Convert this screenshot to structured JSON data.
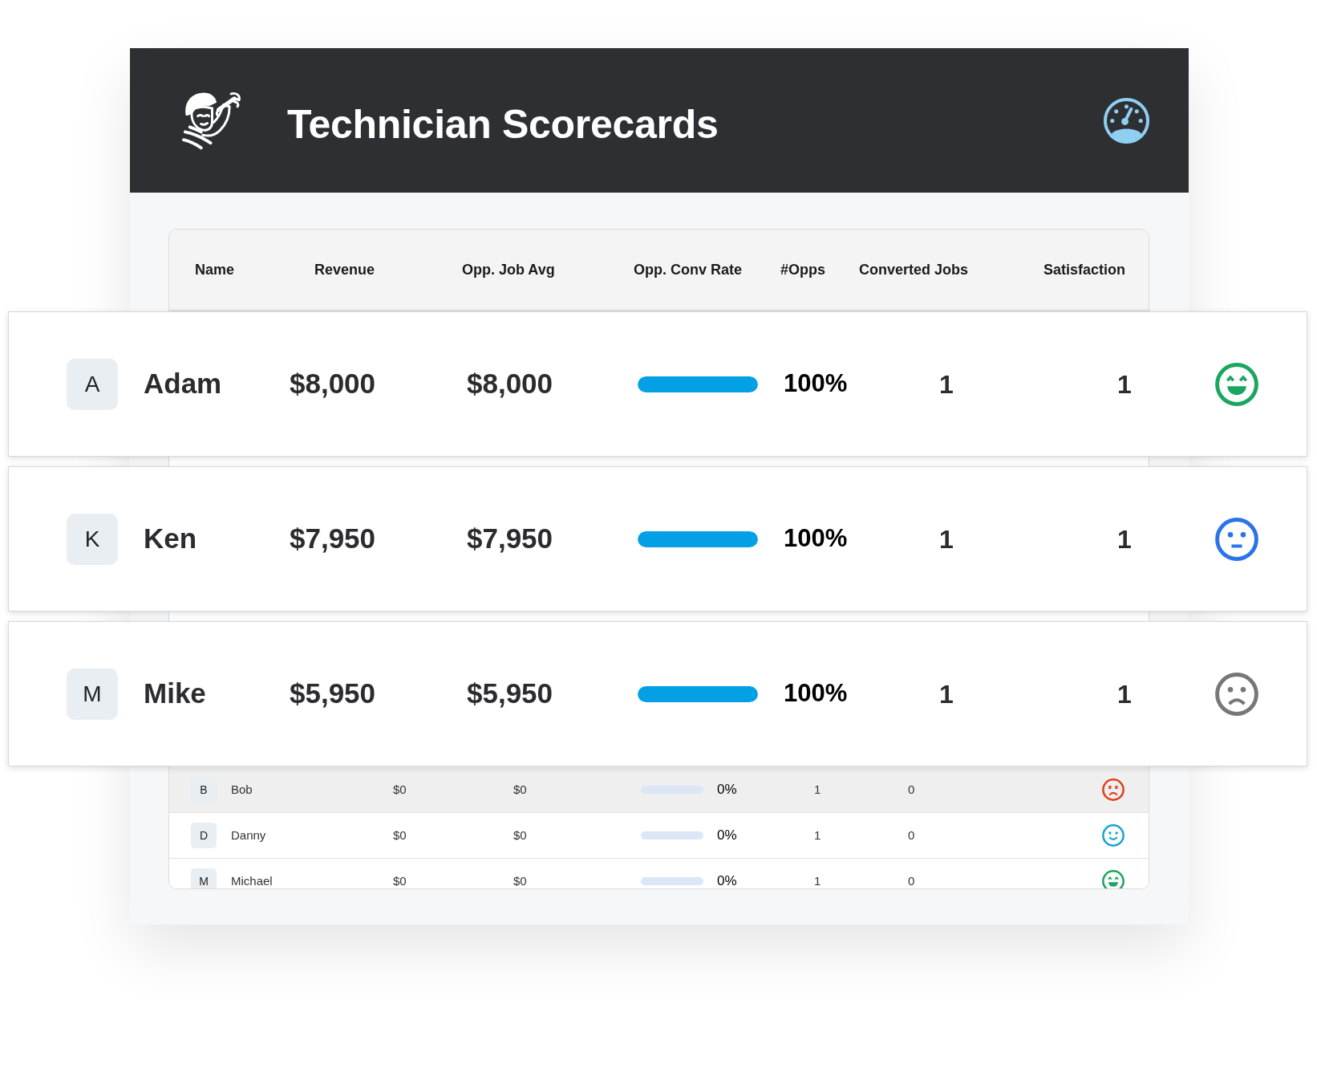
{
  "header": {
    "title": "Technician Scorecards"
  },
  "table": {
    "columns": [
      "Name",
      "Revenue",
      "Opp. Job Avg",
      "Opp. Conv Rate",
      "#Opps",
      "Converted Jobs",
      "Satisfaction"
    ],
    "rows": [
      {
        "initial": "B",
        "name": "Bob",
        "revenue": "$0",
        "opp_job_avg": "$0",
        "opp_conv_rate": {
          "level": 0,
          "reading": "0%"
        },
        "opps": "1",
        "converted_jobs": "0",
        "satisfaction": {
          "kind": "dizzy",
          "color": "#e2401f"
        },
        "highlighted": true
      },
      {
        "initial": "D",
        "name": "Danny",
        "revenue": "$0",
        "opp_job_avg": "$0",
        "opp_conv_rate": {
          "level": 0,
          "reading": "0%"
        },
        "opps": "1",
        "converted_jobs": "0",
        "satisfaction": {
          "kind": "smile",
          "color": "#17a5cf"
        },
        "highlighted": false
      },
      {
        "initial": "M",
        "name": "Michael",
        "revenue": "$0",
        "opp_job_avg": "$0",
        "opp_conv_rate": {
          "level": 0,
          "reading": "0%"
        },
        "opps": "1",
        "converted_jobs": "0",
        "satisfaction": {
          "kind": "laughing",
          "color": "#1ba660"
        },
        "highlighted": false
      }
    ]
  },
  "featured_rows": [
    {
      "initial": "A",
      "name": "Adam",
      "revenue": "$8,000",
      "opp_job_avg": "$8,000",
      "opp_conv_rate": {
        "level": 1,
        "reading": "100%"
      },
      "opps": "1",
      "converted_jobs": "1",
      "satisfaction": {
        "kind": "laughing",
        "color": "#1ba660"
      }
    },
    {
      "initial": "K",
      "name": "Ken",
      "revenue": "$7,950",
      "opp_job_avg": "$7,950",
      "opp_conv_rate": {
        "level": 1,
        "reading": "100%"
      },
      "opps": "1",
      "converted_jobs": "1",
      "satisfaction": {
        "kind": "neutral",
        "color": "#2b73ea"
      }
    },
    {
      "initial": "M",
      "name": "Mike",
      "revenue": "$5,950",
      "opp_job_avg": "$5,950",
      "opp_conv_rate": {
        "level": 1,
        "reading": "100%"
      },
      "opps": "1",
      "converted_jobs": "1",
      "satisfaction": {
        "kind": "sad",
        "color": "#777777"
      }
    }
  ]
}
